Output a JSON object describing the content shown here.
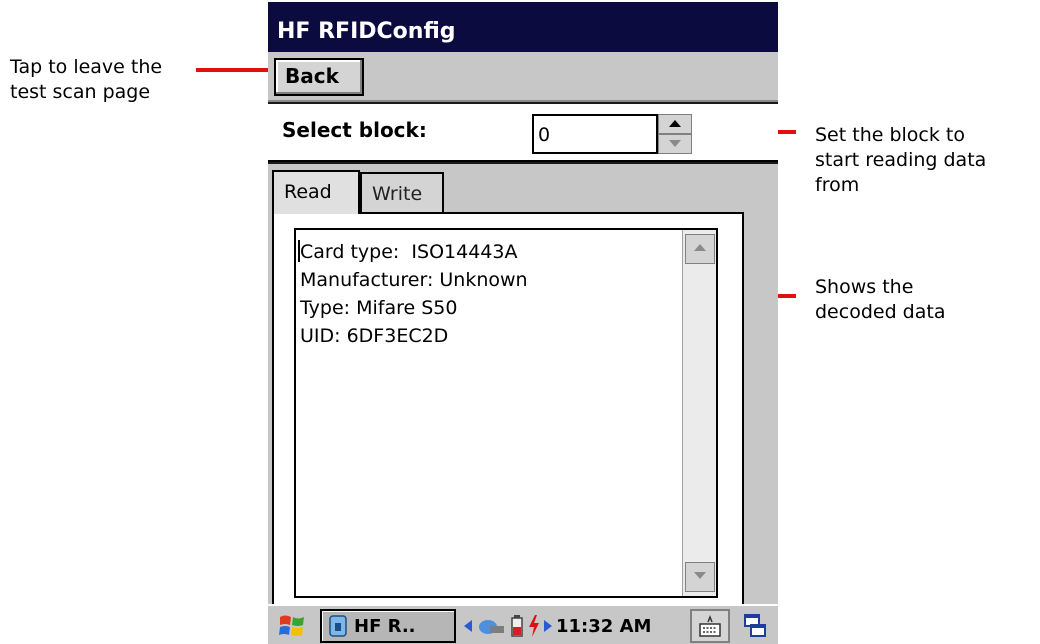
{
  "annotations": {
    "back": [
      "Tap to leave the",
      "test scan page"
    ],
    "block": [
      "Set the block to",
      "start reading data",
      "from"
    ],
    "decoded": [
      "Shows the",
      "decoded data"
    ]
  },
  "app": {
    "title": "HF RFIDConfig",
    "back_label": "Back",
    "select_block_label": "Select block:",
    "select_block_value": "0",
    "tabs": [
      {
        "label": "Read",
        "active": true
      },
      {
        "label": "Write",
        "active": false
      }
    ],
    "read_lines": [
      "Card type:  ISO14443A",
      "Manufacturer: Unknown",
      "Type: Mifare S50",
      "UID: 6DF3EC2D"
    ]
  },
  "taskbar": {
    "start_icon": "windows-flag-icon",
    "task_label": "HF R..",
    "time": "11:32 AM",
    "colors": {
      "red": "#e01010",
      "title_bg": "#0b0b3f"
    }
  }
}
